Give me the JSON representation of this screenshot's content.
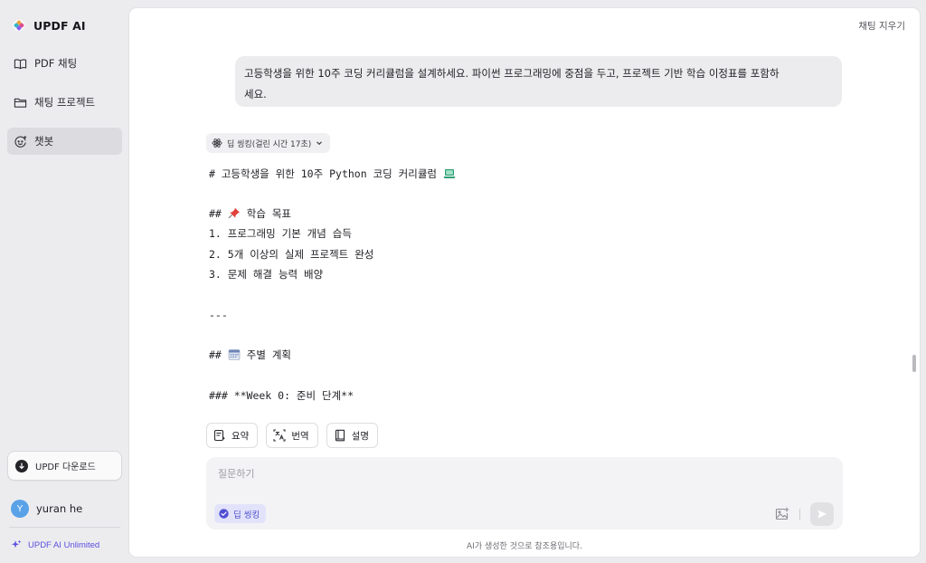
{
  "app": {
    "brand_name": "UPDF AI",
    "accent": "#5b4fe0"
  },
  "sidebar": {
    "items": [
      {
        "label": "PDF 채팅",
        "icon": "book-open-icon"
      },
      {
        "label": "채팅 프로젝트",
        "icon": "folder-icon"
      },
      {
        "label": "챗봇",
        "icon": "chatbot-icon",
        "active": true
      }
    ],
    "download_label": "UPDF 다운로드",
    "user": {
      "initial": "Y",
      "name": "yuran he"
    },
    "plan_label": "UPDF AI Unlimited"
  },
  "header": {
    "clear_chat": "채팅 지우기"
  },
  "conversation": {
    "user_message_line1": "고등학생을 위한 10주 코딩 커리큘럼을 설계하세요. 파이썬 프로그래밍에 중점을 두고, 프로젝트 기반 학습 이정표를 포함하",
    "user_message_line2": "세요.",
    "thinking_chip": "딥 씽킹(걸린 시간 17초)",
    "response": {
      "title_line": "# 고등학생을 위한 10주 Python 코딩 커리큘럼",
      "goals_prefix": "##",
      "goals_heading": "학습 목표",
      "goals": [
        "1. 프로그래밍 기본 개념 습득",
        "2. 5개 이상의 실제 프로젝트 완성",
        "3. 문제 해결 능력 배양"
      ],
      "separator": "---",
      "plan_prefix": "##",
      "plan_heading": "주별 계획",
      "week0": "### **Week 0: 준비 단계**"
    },
    "actions": [
      "요약",
      "번역",
      "설명"
    ]
  },
  "composer": {
    "placeholder": "질문하기",
    "value": "",
    "deep_thinking_label": "딥 씽킹"
  },
  "footer": {
    "disclaimer": "AI가 생성한 것으로 참조용입니다."
  }
}
